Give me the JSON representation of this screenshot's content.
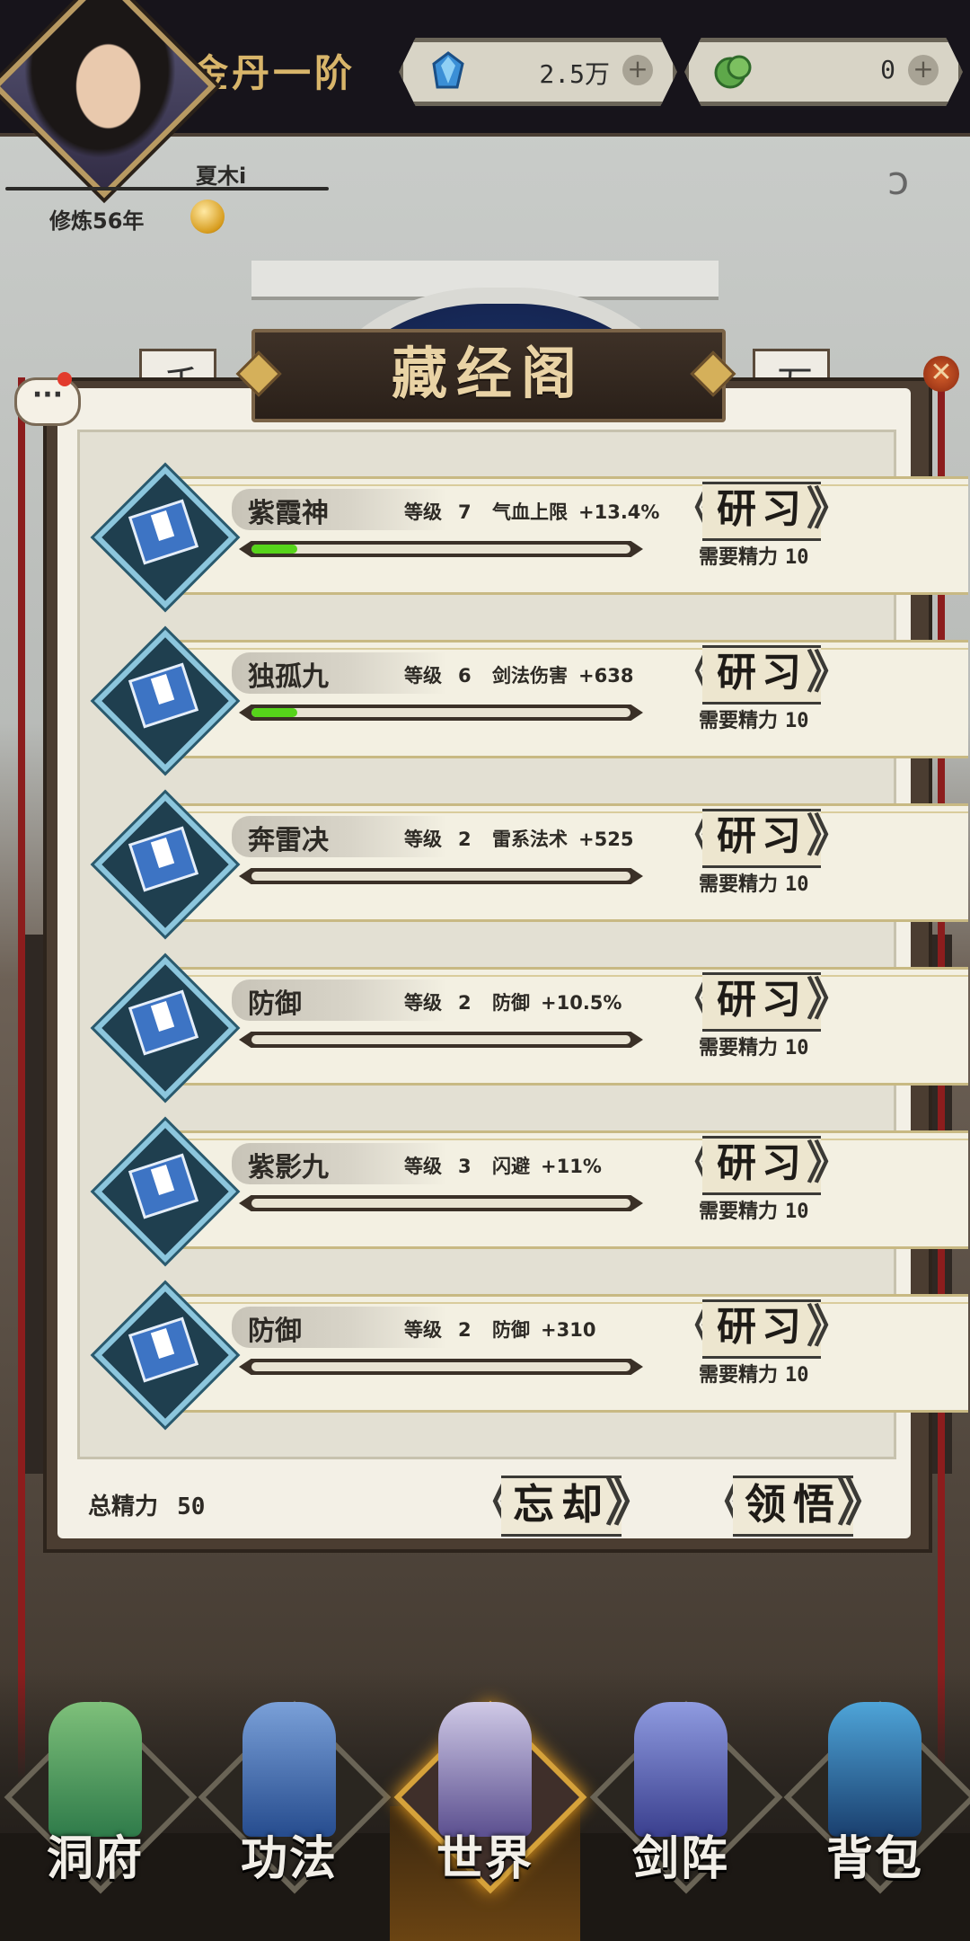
{
  "header": {
    "realm": "金丹一阶",
    "player_name": "夏木i",
    "cultivation": "修炼56年",
    "resources": [
      {
        "icon": "spirit-crystal-icon",
        "value": "2.5万"
      },
      {
        "icon": "jade-coin-icon",
        "value": "0"
      }
    ]
  },
  "background": {
    "scroll_left": "千条稍",
    "scroll_right": "万道辈"
  },
  "panel": {
    "title": "藏经阁",
    "skills": [
      {
        "name": "紫霞神",
        "level_label": "等级",
        "level": "7",
        "stat": "气血上限",
        "bonus": "+13.4%",
        "progress": 0.12,
        "button": "研习",
        "need_label": "需要精力",
        "need": "10"
      },
      {
        "name": "独孤九",
        "level_label": "等级",
        "level": "6",
        "stat": "剑法伤害",
        "bonus": "+638",
        "progress": 0.12,
        "button": "研习",
        "need_label": "需要精力",
        "need": "10"
      },
      {
        "name": "奔雷决",
        "level_label": "等级",
        "level": "2",
        "stat": "雷系法术",
        "bonus": "+525",
        "progress": 0,
        "button": "研习",
        "need_label": "需要精力",
        "need": "10"
      },
      {
        "name": "防御",
        "level_label": "等级",
        "level": "2",
        "stat": "防御",
        "bonus": "+10.5%",
        "progress": 0,
        "button": "研习",
        "need_label": "需要精力",
        "need": "10"
      },
      {
        "name": "紫影九",
        "level_label": "等级",
        "level": "3",
        "stat": "闪避",
        "bonus": "+11%",
        "progress": 0,
        "button": "研习",
        "need_label": "需要精力",
        "need": "10"
      },
      {
        "name": "防御",
        "level_label": "等级",
        "level": "2",
        "stat": "防御",
        "bonus": "+310",
        "progress": 0,
        "button": "研习",
        "need_label": "需要精力",
        "need": "10"
      }
    ],
    "total_label": "总精力",
    "total_value": "50",
    "forget_button": "忘却",
    "comprehend_button": "领悟"
  },
  "nav": [
    {
      "label": "洞府",
      "icon": "cave-mansion-icon"
    },
    {
      "label": "功法",
      "icon": "technique-book-icon"
    },
    {
      "label": "世界",
      "icon": "world-map-icon",
      "active": true
    },
    {
      "label": "剑阵",
      "icon": "sword-formation-icon"
    },
    {
      "label": "背包",
      "icon": "backpack-icon"
    }
  ],
  "colors": {
    "progress_fill": "#56d41a",
    "accent_gold": "#d8b56a",
    "notification": "#e23b2d"
  }
}
